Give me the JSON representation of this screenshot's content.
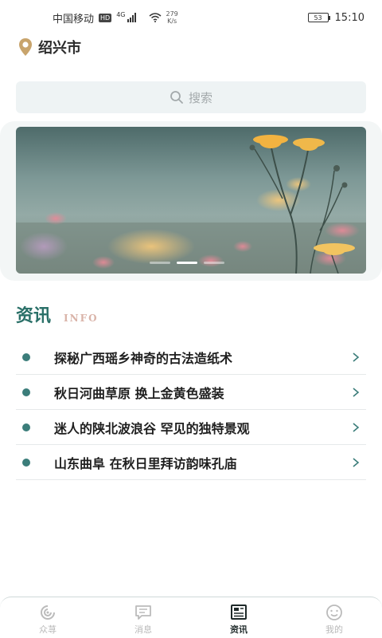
{
  "status_bar": {
    "carrier": "中国移动",
    "hd": "HD",
    "network": "4G",
    "speed_value": "279",
    "speed_unit": "K/s",
    "battery": "53",
    "time": "15:10"
  },
  "location": {
    "city": "绍兴市",
    "icon": "location-pin-icon"
  },
  "search": {
    "placeholder": "搜索",
    "icon": "search-icon"
  },
  "banner": {
    "slide_count": 3,
    "active_slide": 2
  },
  "news_section": {
    "title": "资讯",
    "subtitle": "INFO",
    "items": [
      {
        "title": "探秘广西瑶乡神奇的古法造纸术"
      },
      {
        "title": "秋日河曲草原 换上金黄色盛装"
      },
      {
        "title": "迷人的陕北波浪谷 罕见的独特景观"
      },
      {
        "title": "山东曲阜 在秋日里拜访韵味孔庙"
      }
    ]
  },
  "bottom_nav": {
    "items": [
      {
        "label": "众荨",
        "icon": "swirl-icon",
        "active": false
      },
      {
        "label": "消息",
        "icon": "message-icon",
        "active": false
      },
      {
        "label": "资讯",
        "icon": "news-icon",
        "active": true
      },
      {
        "label": "我的",
        "icon": "smiley-icon",
        "active": false
      }
    ]
  },
  "colors": {
    "accent": "#2a7068",
    "bullet": "#3b7d7a",
    "info_label": "#d9b3a8",
    "search_bg": "#eef3f4"
  }
}
